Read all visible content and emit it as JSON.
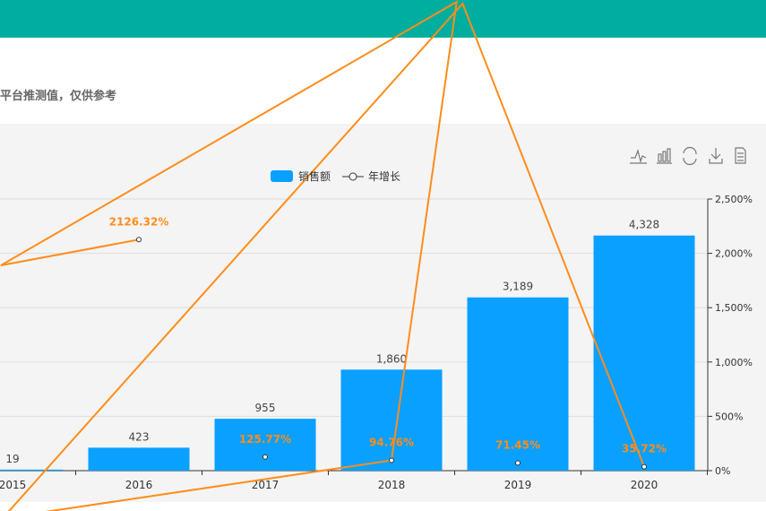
{
  "header": {
    "note": "平台推测值，仅供参考"
  },
  "toolbar": [
    "line-chart-icon",
    "bar-chart-icon",
    "refresh-icon",
    "download-icon",
    "data-view-icon"
  ],
  "chart_data": {
    "type": "bar+line",
    "categories": [
      "2015",
      "2016",
      "2017",
      "2018",
      "2019",
      "2020"
    ],
    "series": [
      {
        "name": "销售额",
        "type": "bar",
        "axis": "left",
        "values": [
          19,
          423,
          955,
          1860,
          3189,
          4328
        ],
        "labels": [
          "19",
          "423",
          "955",
          "1,860",
          "3,189",
          "4,328"
        ],
        "color": "#0aa0ff"
      },
      {
        "name": "年增长",
        "type": "line",
        "axis": "right",
        "values": [
          null,
          2126.32,
          125.77,
          94.76,
          71.45,
          35.72
        ],
        "labels": [
          "",
          "2126.32%",
          "125.77%",
          "94.76%",
          "71.45%",
          "35.72%"
        ],
        "color": "#ff8c1a"
      }
    ],
    "left_ylim": [
      0,
      5000
    ],
    "right_ylim": [
      0,
      2500
    ],
    "right_ticks": [
      "0%",
      "500%",
      "1,000%",
      "1,500%",
      "2,000%",
      "2,500%"
    ],
    "legend": {
      "position": "top-center",
      "items": [
        "销售额",
        "年增长"
      ]
    },
    "grid": true
  }
}
